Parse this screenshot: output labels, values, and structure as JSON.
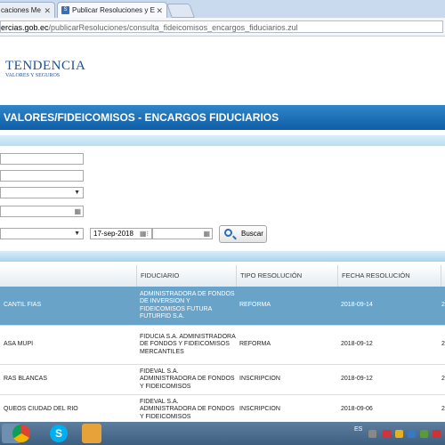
{
  "browser": {
    "tabs": [
      {
        "label": "caciones Me",
        "active": false
      },
      {
        "label": "Publicar Resoluciones y E",
        "active": true
      }
    ],
    "url_host": "ercias.gob.ec",
    "url_path": "/publicarResoluciones/consulta_fideicomisos_encargos_fiduciarios.zul"
  },
  "logo": {
    "line1": "TENDENCIA",
    "line2": "VALORES Y SEGUROS"
  },
  "page": {
    "title": "VALORES/FIDEICOMISOS - ENCARGOS FIDUCIARIOS",
    "date_to": "17-sep-2018",
    "buscar": "Buscar"
  },
  "grid": {
    "headers": [
      "FIDUCIARIO",
      "TIPO RESOLUCIÓN",
      "FECHA RESOLUCIÓN"
    ],
    "rows": [
      {
        "name": "CANTIL FIAS",
        "fiduciario": "ADMINISTRADORA DE FONDOS DE INVERSION Y FIDEICOMISOS FUTURA FUTURFID S.A.",
        "tipo": "REFORMA",
        "fecha": "2018-09-14",
        "extra": "2",
        "selected": true
      },
      {
        "name": "ASA MUPI",
        "fiduciario": "FIDUCIA S.A. ADMINISTRADORA DE FONDOS Y FIDEICOMISOS MERCANTILES",
        "tipo": "REFORMA",
        "fecha": "2018-09-12",
        "extra": "2",
        "selected": false
      },
      {
        "name": "RAS BLANCAS",
        "fiduciario": "FIDEVAL S.A. ADMINISTRADORA DE FONDOS Y FIDEICOMISOS",
        "tipo": "INSCRIPCION",
        "fecha": "2018-09-12",
        "extra": "2",
        "selected": false
      },
      {
        "name": "QUEOS CIUDAD DEL RIO",
        "fiduciario": "FIDEVAL S.A. ADMINISTRADORA DE FONDOS Y FIDEICOMISOS",
        "tipo": "INSCRIPCION",
        "fecha": "2018-09-06",
        "extra": "2",
        "selected": false
      }
    ]
  },
  "taskbar": {
    "lang": "ES"
  },
  "colors": {
    "title_bar": "#0f5ea6",
    "selected_row": "#6aa3c8"
  }
}
